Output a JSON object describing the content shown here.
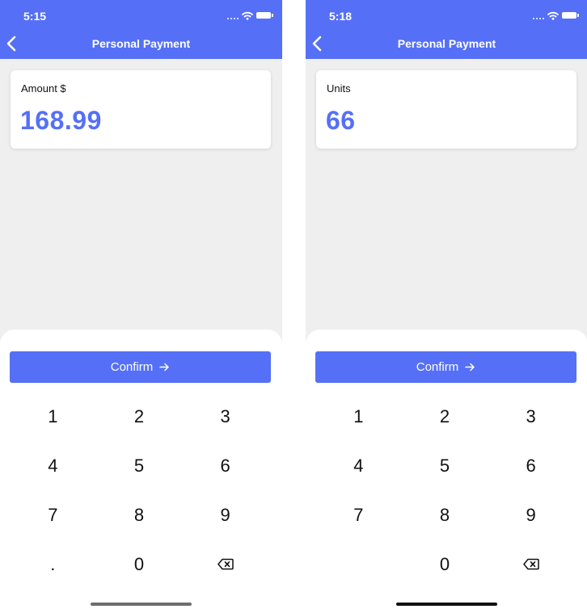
{
  "screens": [
    {
      "status_time": "5:15",
      "title": "Personal Payment",
      "field_label": "Amount $",
      "field_value": "168.99",
      "confirm_label": "Confirm",
      "keys": [
        "1",
        "2",
        "3",
        "4",
        "5",
        "6",
        "7",
        "8",
        "9",
        ".",
        "0",
        "backspace"
      ]
    },
    {
      "status_time": "5:18",
      "title": "Personal Payment",
      "field_label": "Units",
      "field_value": "66",
      "confirm_label": "Confirm",
      "keys": [
        "1",
        "2",
        "3",
        "4",
        "5",
        "6",
        "7",
        "8",
        "9",
        "",
        "0",
        "backspace"
      ]
    }
  ],
  "colors": {
    "accent": "#5570f6",
    "background": "#efefef",
    "card": "#ffffff"
  },
  "icons": {
    "back": "chevron-left-icon",
    "arrow": "arrow-right-icon",
    "backspace": "backspace-icon",
    "wifi": "wifi-icon",
    "battery": "battery-icon"
  }
}
